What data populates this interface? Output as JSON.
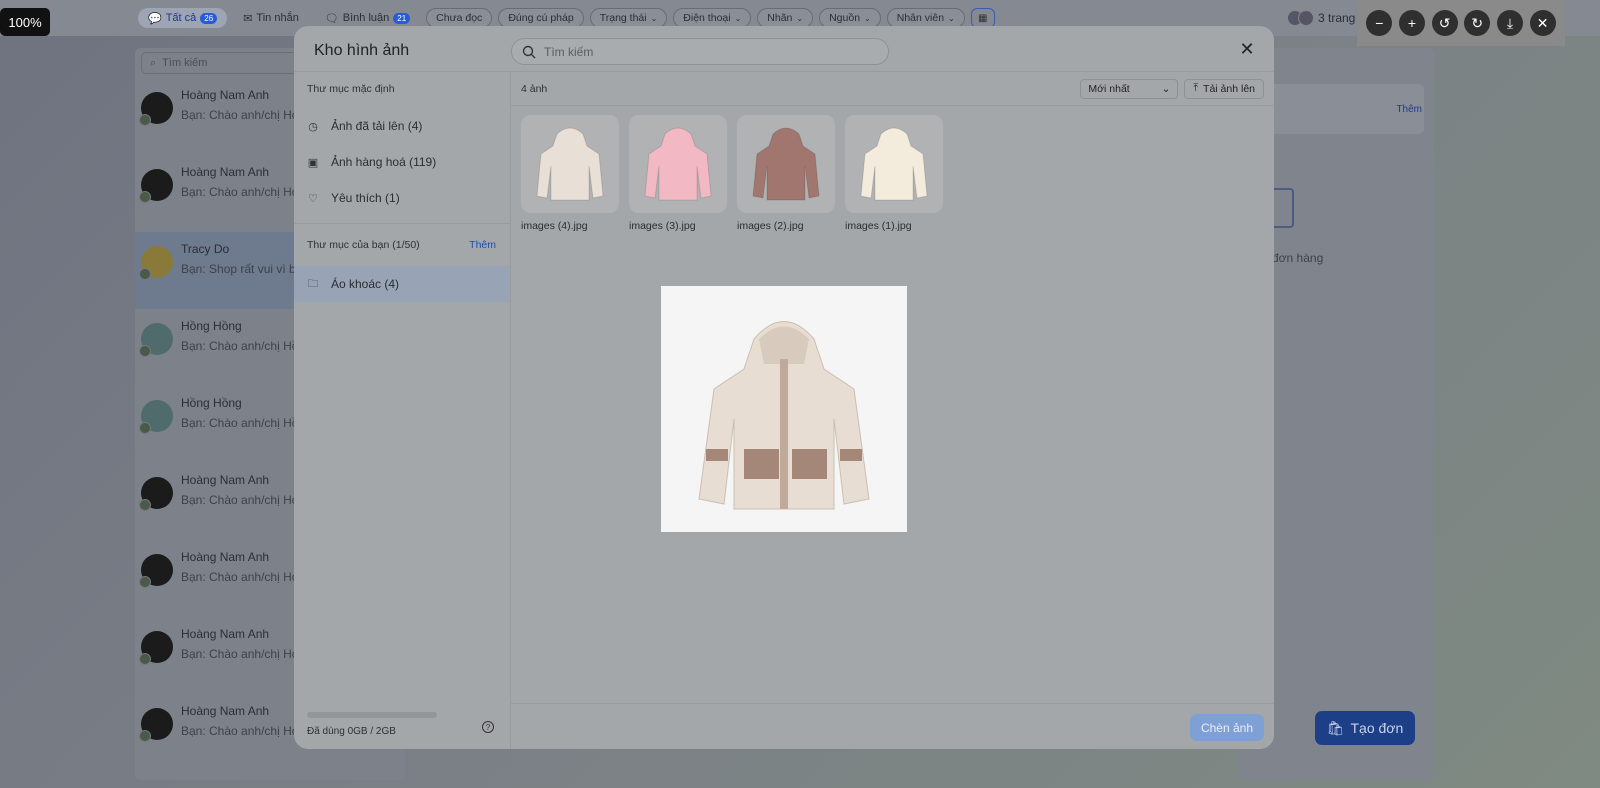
{
  "viewer": {
    "zoom": "100%"
  },
  "top_bar": {
    "tabs": [
      {
        "label": "Tất cả",
        "badge": "26"
      },
      {
        "label": "Tin nhắn",
        "badge": ""
      },
      {
        "label": "Bình luận",
        "badge": "21"
      }
    ],
    "filters": [
      "Chưa đọc",
      "Đúng cú pháp",
      "Trạng thái",
      "Điện thoại",
      "Nhãn",
      "Nguồn",
      "Nhân viên"
    ],
    "pages_label": "3 trang"
  },
  "left_panel": {
    "search_placeholder": "Tìm kiếm",
    "conversations": [
      {
        "name": "Hoàng Nam Anh",
        "preview": "Bạn: Chào anh/chị Hoàng"
      },
      {
        "name": "Hoàng Nam Anh",
        "preview": "Bạn: Chào anh/chị Hoàng"
      },
      {
        "name": "Tracy Do",
        "preview": "Bạn: Shop rất vui vì bạn"
      },
      {
        "name": "Hồng Hồng",
        "preview": "Bạn: Chào anh/chị Hồng"
      },
      {
        "name": "Hồng Hồng",
        "preview": "Bạn: Chào anh/chị Hồng"
      },
      {
        "name": "Hoàng Nam Anh",
        "preview": "Bạn: Chào anh/chị Hoàng"
      },
      {
        "name": "Hoàng Nam Anh",
        "preview": "Bạn: Chào anh/chị Hoàng"
      },
      {
        "name": "Hoàng Nam Anh",
        "preview": "Bạn: Chào anh/chị Hoàng"
      },
      {
        "name": "Hoàng Nam Anh",
        "preview": "Bạn: Chào anh/chị Hoàng Nam Anh"
      }
    ]
  },
  "right_panel": {
    "add_label": "Thêm",
    "empty_text": "đơn hàng",
    "create_order_label": "Tạo đơn"
  },
  "modal": {
    "title": "Kho hình ảnh",
    "search_placeholder": "Tìm kiếm",
    "default_folders_heading": "Thư mục mặc định",
    "default_folders": [
      {
        "label": "Ảnh đã tải lên (4)",
        "icon": "clock-icon"
      },
      {
        "label": "Ảnh hàng hoá (119)",
        "icon": "image-icon"
      },
      {
        "label": "Yêu thích (1)",
        "icon": "heart-icon"
      }
    ],
    "user_folders_heading": "Thư mục của bạn (1/50)",
    "user_folders_add": "Thêm",
    "user_folders": [
      {
        "label": "Áo khoác (4)",
        "icon": "folder-icon"
      }
    ],
    "storage_text": "Đã dùng 0GB / 2GB",
    "storage_used_fraction": 0,
    "image_count": "4 ảnh",
    "sort_value": "Mới nhất",
    "upload_label": "Tải ảnh lên",
    "images": [
      {
        "name": "images (4).jpg",
        "color": "#e8dfd6"
      },
      {
        "name": "images (3).jpg",
        "color": "#f2b9c4"
      },
      {
        "name": "images (2).jpg",
        "color": "#a0766f"
      },
      {
        "name": "images (1).jpg",
        "color": "#f3ecdc"
      }
    ],
    "insert_label": "Chèn ảnh"
  }
}
